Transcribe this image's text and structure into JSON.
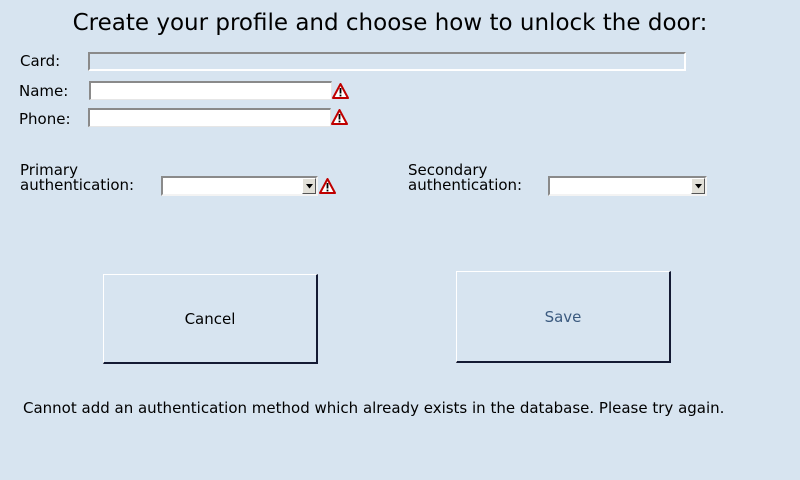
{
  "title": "Create your profile and choose how to unlock the door:",
  "form": {
    "card": {
      "label": "Card:",
      "value": ""
    },
    "name": {
      "label": "Name:",
      "value": ""
    },
    "phone": {
      "label": "Phone:",
      "value": ""
    },
    "primary_auth": {
      "label_line1": "Primary",
      "label_line2": "authentication:",
      "selected": ""
    },
    "secondary_auth": {
      "label_line1": "Secondary",
      "label_line2": "authentication:",
      "selected": ""
    }
  },
  "buttons": {
    "cancel": "Cancel",
    "save": "Save"
  },
  "message": "Cannot add an authentication method which already exists in the database. Please try again.",
  "colors": {
    "background": "#d7e4f0",
    "warning_red": "#c00000",
    "save_text": "#3b5a7f",
    "button_shadow": "#141a33"
  }
}
